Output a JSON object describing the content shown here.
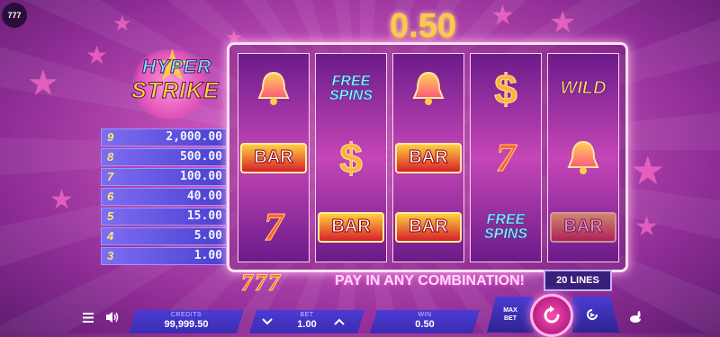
{
  "brand": {
    "badge": "777"
  },
  "win_display": "0.50",
  "logo": {
    "line1": "HYPER",
    "line2": "STRIKE"
  },
  "paytable": [
    {
      "count": "9",
      "value": "2,000.00"
    },
    {
      "count": "8",
      "value": "500.00"
    },
    {
      "count": "7",
      "value": "100.00"
    },
    {
      "count": "6",
      "value": "40.00"
    },
    {
      "count": "5",
      "value": "15.00"
    },
    {
      "count": "4",
      "value": "5.00"
    },
    {
      "count": "3",
      "value": "1.00"
    }
  ],
  "reels": [
    [
      "bell",
      "BAR",
      "7"
    ],
    [
      "FREE SPINS",
      "$",
      "BAR"
    ],
    [
      "bell",
      "BAR",
      "BAR"
    ],
    [
      "$",
      "7",
      "FREE SPINS"
    ],
    [
      "WILD",
      "bell",
      "BAR"
    ]
  ],
  "symbols": {
    "bar": "BAR",
    "seven": "7",
    "dollar": "$",
    "free1": "FREE",
    "free2": "SPINS",
    "wild": "WILD"
  },
  "lines_label": "20 LINES",
  "combo": {
    "sevens": "777",
    "text": "PAY IN ANY COMBINATION!"
  },
  "controls": {
    "credits_label": "CREDITS",
    "credits_value": "99,999.50",
    "bet_label": "BET",
    "bet_value": "1.00",
    "win_label": "WIN",
    "win_value": "0.50",
    "maxbet_line1": "MAX",
    "maxbet_line2": "BET"
  },
  "colors": {
    "accent": "#ffc74d",
    "panel": "#4b3bd6",
    "spin": "#ff4fb3"
  }
}
